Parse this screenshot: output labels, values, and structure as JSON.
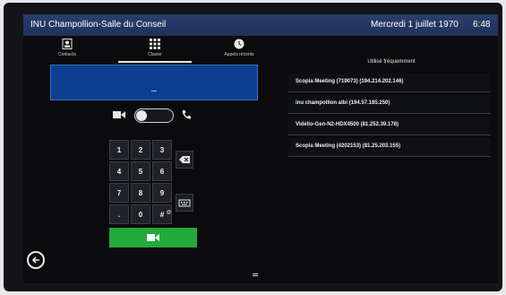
{
  "header": {
    "room_name": "INU Champollion-Salle du Conseil",
    "date": "Mercredi 1 juillet 1970",
    "time": "6:48"
  },
  "tabs": [
    {
      "label": "Contacts",
      "icon": "contacts-icon"
    },
    {
      "label": "Clavier",
      "icon": "keypad-icon",
      "active": true
    },
    {
      "label": "Appels récents",
      "icon": "recent-calls-icon"
    }
  ],
  "dial_entry": {
    "value": "_"
  },
  "call_mode": {
    "video_icon": "video-camera-icon",
    "audio_icon": "phone-icon",
    "selected": "video"
  },
  "keypad": {
    "keys": [
      "1",
      "2",
      "3",
      "4",
      "5",
      "6",
      "7",
      "8",
      "9",
      ".",
      "0",
      "#"
    ],
    "sub_labels": [
      "",
      "",
      "",
      "",
      "",
      "",
      "",
      "",
      "",
      "",
      "",
      "@"
    ],
    "backspace_icon": "backspace-icon",
    "keyboard_icon": "keyboard-icon",
    "call_icon": "video-camera-icon"
  },
  "favorites": {
    "heading": "Utilisé fréquemment",
    "items": [
      "Scopia Meeting (719073) (194.214.202.146)",
      "inu champollion albi (194.57.185.250)",
      "Vidélio-Gen-N2-HDX4500 (81.252.39.178)",
      "Scopia Meeting (4202153) (81.25.203.155)"
    ]
  },
  "colors": {
    "header_bg": "#1f3159",
    "entry_bg": "#0c3f8f",
    "call_button": "#23a83a",
    "screen_bg": "#0b0b0e"
  },
  "nav": {
    "back_icon": "back-arrow-icon",
    "bottom_icon": "menu-handle-icon"
  }
}
